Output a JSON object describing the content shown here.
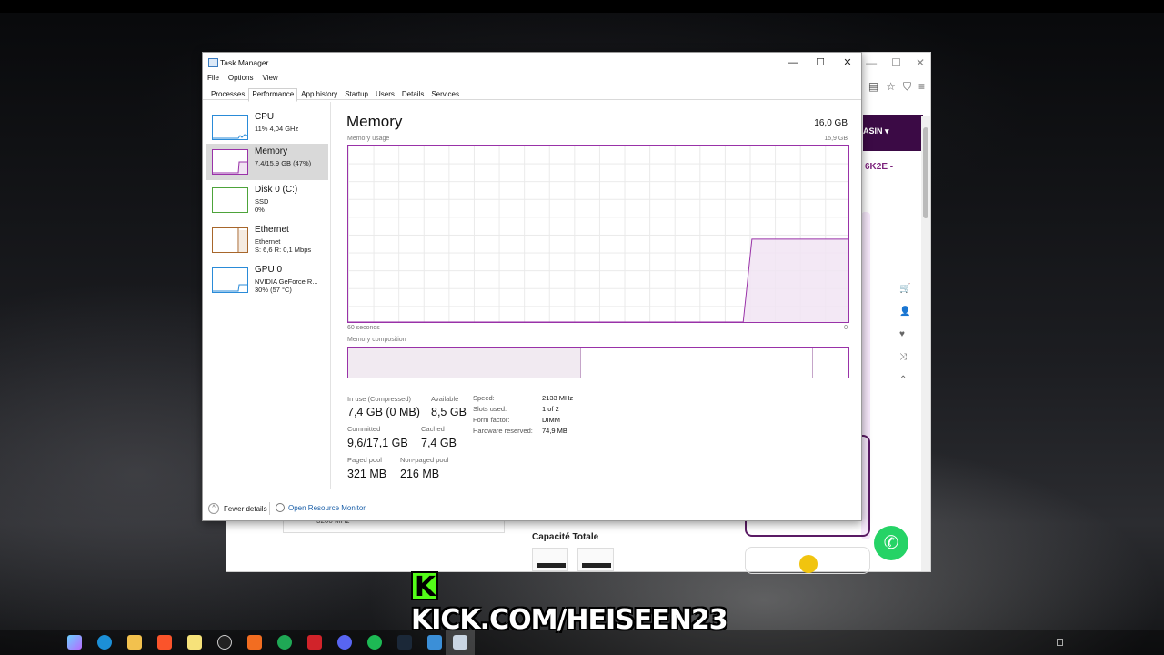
{
  "window": {
    "title": "Task Manager",
    "controls": {
      "minimize": "—",
      "maximize": "☐",
      "close": "✕"
    }
  },
  "menu": [
    "File",
    "Options",
    "View"
  ],
  "tabs": [
    "Processes",
    "Performance",
    "App history",
    "Startup",
    "Users",
    "Details",
    "Services"
  ],
  "active_tab": "Performance",
  "sidebar": {
    "items": [
      {
        "name": "CPU",
        "sub1": "11% 4,04 GHz",
        "sub2": "",
        "sub3": "",
        "color": "#2a8bd8"
      },
      {
        "name": "Memory",
        "sub1": "7,4/15,9 GB (47%)",
        "sub2": "",
        "sub3": "",
        "color": "#9932a8"
      },
      {
        "name": "Disk 0 (C:)",
        "sub1": "SSD",
        "sub2": "0%",
        "sub3": "",
        "color": "#4da33a"
      },
      {
        "name": "Ethernet",
        "sub1": "Ethernet",
        "sub2": "S: 6,6  R: 0,1 Mbps",
        "sub3": "",
        "color": "#a7662b"
      },
      {
        "name": "GPU 0",
        "sub1": "NVIDIA GeForce R...",
        "sub2": "30% (57 °C)",
        "sub3": "",
        "color": "#2a8bd8"
      }
    ],
    "selected": "Memory"
  },
  "main": {
    "title": "Memory",
    "total": "16,0 GB",
    "graph_label": "Memory usage",
    "graph_max": "15,9 GB",
    "time_left": "60 seconds",
    "time_right": "0",
    "composition_label": "Memory composition",
    "composition_in_use_fraction": 0.465,
    "composition_standby_fraction": 0.463,
    "usage_series_fraction": [
      0,
      0,
      0,
      0,
      0,
      0,
      0,
      0,
      0,
      0,
      0,
      0,
      0,
      0,
      0,
      0,
      0,
      0,
      0,
      0,
      0,
      0,
      0,
      0,
      0,
      0,
      0,
      0,
      0,
      0,
      0,
      0,
      0,
      0,
      0,
      0,
      0,
      0,
      0,
      0,
      0,
      0,
      0,
      0,
      0,
      0,
      0.47,
      0.47,
      0.47,
      0.47,
      0.47,
      0.47,
      0.47,
      0.47,
      0.47,
      0.47,
      0.47,
      0.47
    ]
  },
  "stats": {
    "in_use_label": "In use (Compressed)",
    "in_use_value": "7,4 GB (0 MB)",
    "available_label": "Available",
    "available_value": "8,5 GB",
    "committed_label": "Committed",
    "committed_value": "9,6/17,1 GB",
    "cached_label": "Cached",
    "cached_value": "7,4 GB",
    "paged_label": "Paged pool",
    "paged_value": "321 MB",
    "nonpaged_label": "Non-paged pool",
    "nonpaged_value": "216 MB"
  },
  "details": [
    {
      "label": "Speed:",
      "value": "2133 MHz"
    },
    {
      "label": "Slots used:",
      "value": "1 of 2"
    },
    {
      "label": "Form factor:",
      "value": "DIMM"
    },
    {
      "label": "Hardware reserved:",
      "value": "74,9 MB"
    }
  ],
  "footer": {
    "fewer_details": "Fewer details",
    "resource_monitor": "Open Resource Monitor"
  },
  "browser": {
    "nav_button": "ASIN",
    "code_text": "6K2E -",
    "capacity_label": "Capacité Totale",
    "speed_field": "3200 MHz"
  },
  "overlay": {
    "kick_letter": "K",
    "kick_text": "KICK.COM/HEISEEN23"
  },
  "taskbar": {
    "icons": [
      "copilot-icon",
      "edge-icon",
      "file-explorer-icon",
      "brave-icon",
      "notes-icon",
      "speedometer-icon",
      "app-orange-icon",
      "whatsapp-icon",
      "app-red-icon",
      "discord-icon",
      "spotify-icon",
      "steam-icon",
      "photos-icon",
      "task-manager-icon"
    ]
  }
}
